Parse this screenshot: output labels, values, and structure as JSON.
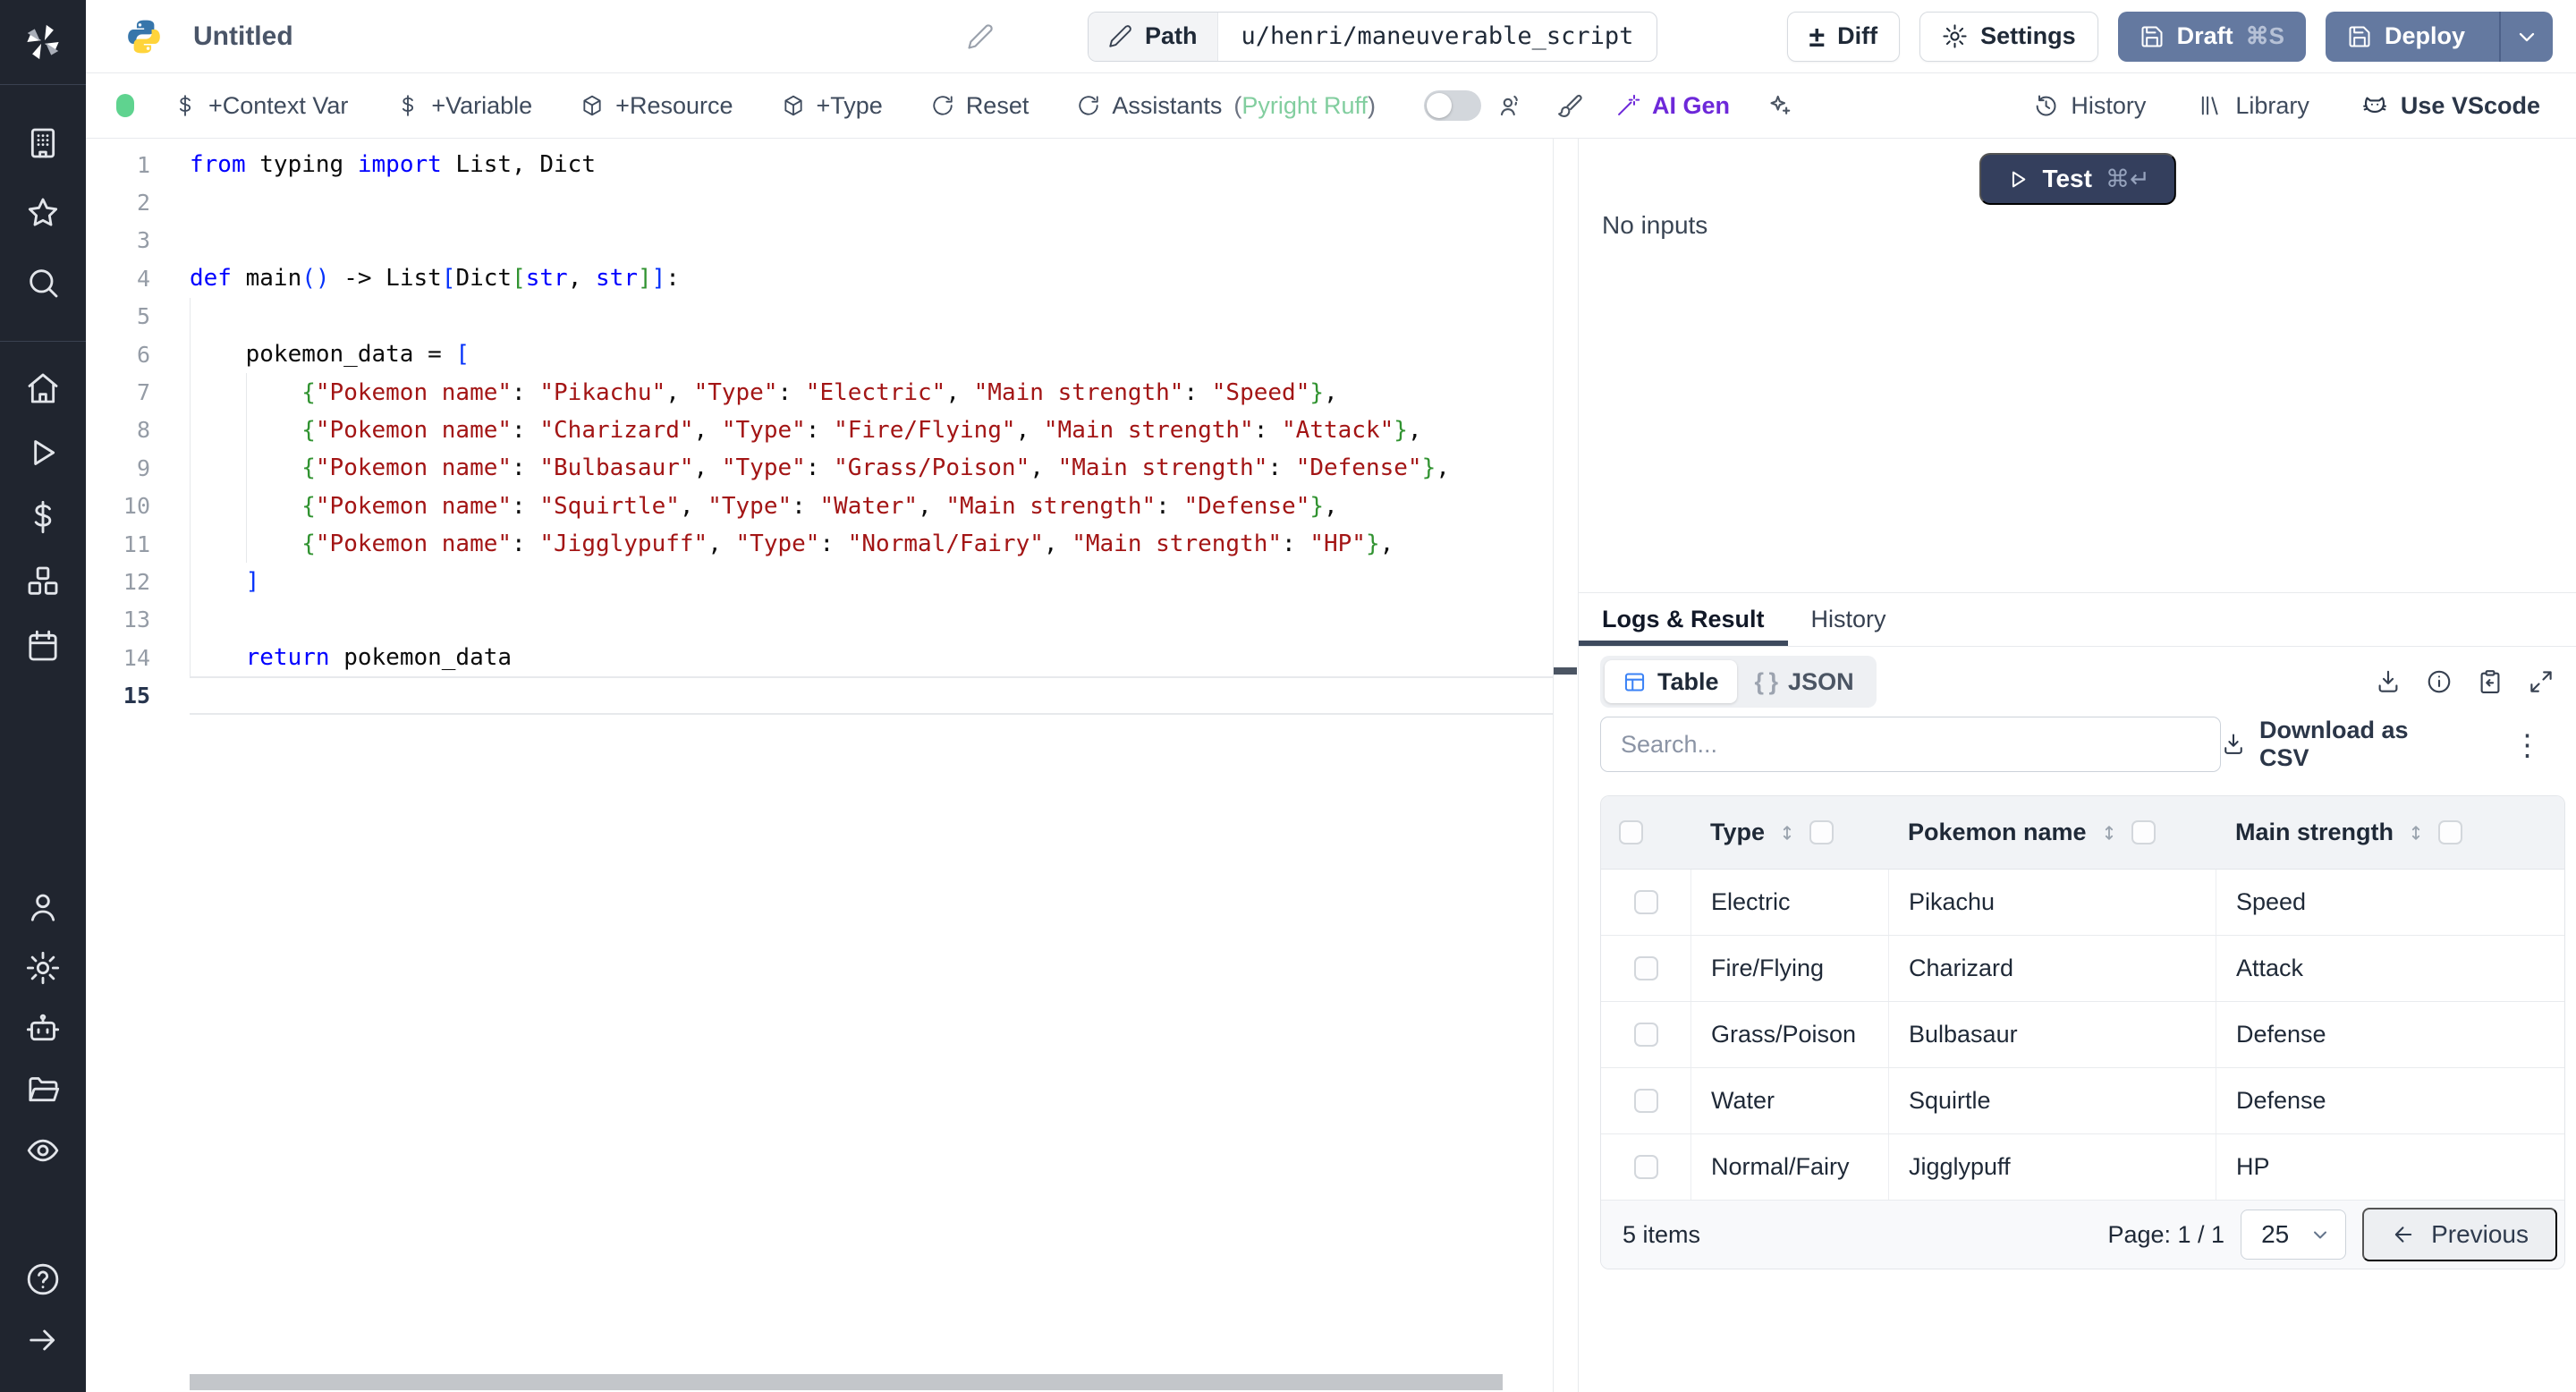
{
  "header": {
    "title": "Untitled",
    "path": {
      "label": "Path",
      "value": "u/henri/maneuverable_script"
    },
    "buttons": {
      "diff": "Diff",
      "settings": "Settings",
      "draft": "Draft",
      "draft_shortcut": "⌘S",
      "deploy": "Deploy"
    }
  },
  "toolbar": {
    "context_var": "+Context Var",
    "variable": "+Variable",
    "resource": "+Resource",
    "type": "+Type",
    "reset": "Reset",
    "assistants": "Assistants",
    "assistants_detail": {
      "open": "(",
      "text": "Pyright Ruff",
      "close": ")"
    },
    "ai_gen": "AI Gen",
    "right": {
      "history": "History",
      "library": "Library",
      "vscode": "Use VScode"
    }
  },
  "editor": {
    "lines": [
      {
        "n": "1",
        "seg": [
          [
            "kw",
            "from"
          ],
          [
            "pl",
            " typing "
          ],
          [
            "kw",
            "import"
          ],
          [
            "pl",
            " List, Dict"
          ]
        ]
      },
      {
        "n": "2",
        "seg": []
      },
      {
        "n": "3",
        "seg": []
      },
      {
        "n": "4",
        "seg": [
          [
            "kw",
            "def"
          ],
          [
            "pl",
            " main"
          ],
          [
            "bb",
            "()"
          ],
          [
            "pl",
            " -> List"
          ],
          [
            "bb",
            "["
          ],
          [
            "pl",
            "Dict"
          ],
          [
            "bg",
            "["
          ],
          [
            "kw",
            "str"
          ],
          [
            "pl",
            ", "
          ],
          [
            "kw",
            "str"
          ],
          [
            "bg",
            "]"
          ],
          [
            "bb",
            "]"
          ],
          [
            "pl",
            ":"
          ]
        ]
      },
      {
        "n": "5",
        "seg": []
      },
      {
        "n": "6",
        "seg": [
          [
            "pl",
            "    pokemon_data = "
          ],
          [
            "bb",
            "["
          ]
        ]
      },
      {
        "n": "7",
        "seg": [
          [
            "pl",
            "        "
          ],
          [
            "bg",
            "{"
          ],
          [
            "str",
            "\"Pokemon name\""
          ],
          [
            "pl",
            ": "
          ],
          [
            "str",
            "\"Pikachu\""
          ],
          [
            "pl",
            ", "
          ],
          [
            "str",
            "\"Type\""
          ],
          [
            "pl",
            ": "
          ],
          [
            "str",
            "\"Electric\""
          ],
          [
            "pl",
            ", "
          ],
          [
            "str",
            "\"Main strength\""
          ],
          [
            "pl",
            ": "
          ],
          [
            "str",
            "\"Speed\""
          ],
          [
            "bg",
            "}"
          ],
          [
            "pl",
            ","
          ]
        ]
      },
      {
        "n": "8",
        "seg": [
          [
            "pl",
            "        "
          ],
          [
            "bg",
            "{"
          ],
          [
            "str",
            "\"Pokemon name\""
          ],
          [
            "pl",
            ": "
          ],
          [
            "str",
            "\"Charizard\""
          ],
          [
            "pl",
            ", "
          ],
          [
            "str",
            "\"Type\""
          ],
          [
            "pl",
            ": "
          ],
          [
            "str",
            "\"Fire/Flying\""
          ],
          [
            "pl",
            ", "
          ],
          [
            "str",
            "\"Main strength\""
          ],
          [
            "pl",
            ": "
          ],
          [
            "str",
            "\"Attack\""
          ],
          [
            "bg",
            "}"
          ],
          [
            "pl",
            ","
          ]
        ]
      },
      {
        "n": "9",
        "seg": [
          [
            "pl",
            "        "
          ],
          [
            "bg",
            "{"
          ],
          [
            "str",
            "\"Pokemon name\""
          ],
          [
            "pl",
            ": "
          ],
          [
            "str",
            "\"Bulbasaur\""
          ],
          [
            "pl",
            ", "
          ],
          [
            "str",
            "\"Type\""
          ],
          [
            "pl",
            ": "
          ],
          [
            "str",
            "\"Grass/Poison\""
          ],
          [
            "pl",
            ", "
          ],
          [
            "str",
            "\"Main strength\""
          ],
          [
            "pl",
            ": "
          ],
          [
            "str",
            "\"Defense\""
          ],
          [
            "bg",
            "}"
          ],
          [
            "pl",
            ","
          ]
        ]
      },
      {
        "n": "10",
        "seg": [
          [
            "pl",
            "        "
          ],
          [
            "bg",
            "{"
          ],
          [
            "str",
            "\"Pokemon name\""
          ],
          [
            "pl",
            ": "
          ],
          [
            "str",
            "\"Squirtle\""
          ],
          [
            "pl",
            ", "
          ],
          [
            "str",
            "\"Type\""
          ],
          [
            "pl",
            ": "
          ],
          [
            "str",
            "\"Water\""
          ],
          [
            "pl",
            ", "
          ],
          [
            "str",
            "\"Main strength\""
          ],
          [
            "pl",
            ": "
          ],
          [
            "str",
            "\"Defense\""
          ],
          [
            "bg",
            "}"
          ],
          [
            "pl",
            ","
          ]
        ]
      },
      {
        "n": "11",
        "seg": [
          [
            "pl",
            "        "
          ],
          [
            "bg",
            "{"
          ],
          [
            "str",
            "\"Pokemon name\""
          ],
          [
            "pl",
            ": "
          ],
          [
            "str",
            "\"Jigglypuff\""
          ],
          [
            "pl",
            ", "
          ],
          [
            "str",
            "\"Type\""
          ],
          [
            "pl",
            ": "
          ],
          [
            "str",
            "\"Normal/Fairy\""
          ],
          [
            "pl",
            ", "
          ],
          [
            "str",
            "\"Main strength\""
          ],
          [
            "pl",
            ": "
          ],
          [
            "str",
            "\"HP\""
          ],
          [
            "bg",
            "}"
          ],
          [
            "pl",
            ","
          ]
        ]
      },
      {
        "n": "12",
        "seg": [
          [
            "pl",
            "    "
          ],
          [
            "bb",
            "]"
          ]
        ]
      },
      {
        "n": "13",
        "seg": []
      },
      {
        "n": "14",
        "seg": [
          [
            "pl",
            "    "
          ],
          [
            "kw",
            "return"
          ],
          [
            "pl",
            " pokemon_data"
          ]
        ]
      },
      {
        "n": "15",
        "seg": [],
        "active": true
      }
    ]
  },
  "run": {
    "test": "Test",
    "test_shortcut": "⌘↵",
    "no_inputs": "No inputs"
  },
  "result": {
    "tabs": [
      "Logs & Result",
      "History"
    ],
    "view_toggle": {
      "table": "Table",
      "json": "JSON"
    },
    "search_placeholder": "Search...",
    "download_csv": "Download as CSV"
  },
  "table": {
    "columns": [
      "Type",
      "Pokemon name",
      "Main strength"
    ],
    "rows": [
      [
        "Electric",
        "Pikachu",
        "Speed"
      ],
      [
        "Fire/Flying",
        "Charizard",
        "Attack"
      ],
      [
        "Grass/Poison",
        "Bulbasaur",
        "Defense"
      ],
      [
        "Water",
        "Squirtle",
        "Defense"
      ],
      [
        "Normal/Fairy",
        "Jigglypuff",
        "HP"
      ]
    ],
    "footer": {
      "items": "5 items",
      "page": "Page: 1 / 1",
      "page_size": "25",
      "previous": "Previous"
    }
  },
  "glyphs": {
    "plus_minus": "±",
    "braces": "{ }",
    "kebab": "⋮"
  },
  "sidebar": {
    "icons": [
      "windmill-logo",
      "building",
      "favorites-star",
      "search",
      "home",
      "runs-play",
      "variables-dollar",
      "resources-boxes",
      "schedules-calendar",
      "user",
      "settings-gear",
      "workers-robot",
      "folders",
      "audit-eye",
      "help",
      "collapse-arrow"
    ]
  },
  "colors": {
    "accent_slate": "#6479a0",
    "test_navy": "#343f5d",
    "ai_purple": "#6d28d9",
    "assist_green": "#82ce9f",
    "table_blue": "#3b82f6",
    "online_green": "#5fd38f",
    "sidebar_bg": "#20252f"
  }
}
